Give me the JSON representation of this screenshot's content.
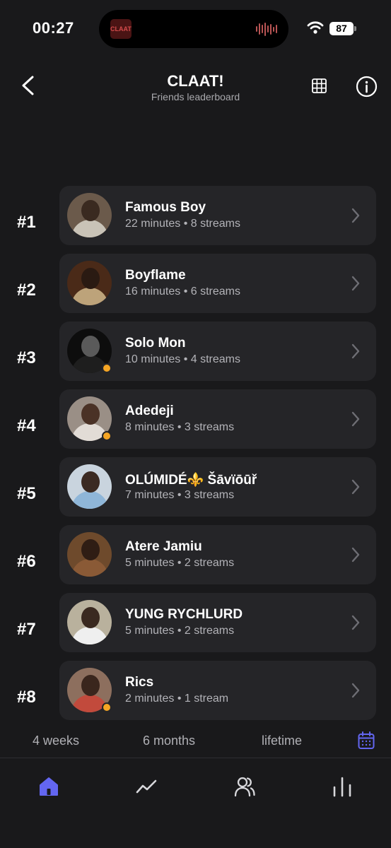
{
  "status_bar": {
    "time": "00:27",
    "battery": "87",
    "island_album_label": "CLAAT!"
  },
  "header": {
    "title": "CLAAT!",
    "subtitle": "Friends leaderboard"
  },
  "leaderboard": [
    {
      "rank": "#1",
      "name": "Famous Boy",
      "stats": "22 minutes • 8 streams",
      "online": false,
      "avatar": {
        "bg": "#6b5a4b",
        "skin": "#3a2a20",
        "shirt": "#c9c3b7"
      }
    },
    {
      "rank": "#2",
      "name": "Boyflame",
      "stats": "16 minutes • 6 streams",
      "online": false,
      "avatar": {
        "bg": "#4a2a18",
        "skin": "#2a1a12",
        "shirt": "#bda37a"
      }
    },
    {
      "rank": "#3",
      "name": "Solo Mon",
      "stats": "10 minutes • 4 streams",
      "online": true,
      "avatar": {
        "bg": "#0d0d0d",
        "skin": "#5a5a5a",
        "shirt": "#1e1e1e"
      }
    },
    {
      "rank": "#4",
      "name": "Adedeji",
      "stats": "8 minutes • 3 streams",
      "online": true,
      "avatar": {
        "bg": "#9a8f86",
        "skin": "#4a3226",
        "shirt": "#e2dcd6"
      }
    },
    {
      "rank": "#5",
      "name": "OLÚMIDÉ⚜️ Šāvïōūř",
      "stats": "7 minutes • 3 streams",
      "online": false,
      "avatar": {
        "bg": "#c9d4de",
        "skin": "#3b2a22",
        "shirt": "#8fb6d8"
      }
    },
    {
      "rank": "#6",
      "name": "Atere Jamiu",
      "stats": "5 minutes • 2 streams",
      "online": false,
      "avatar": {
        "bg": "#6e4a2c",
        "skin": "#2f1d14",
        "shirt": "#8a5a36"
      }
    },
    {
      "rank": "#7",
      "name": "YUNG RYCHLURD",
      "stats": "5 minutes • 2 streams",
      "online": false,
      "avatar": {
        "bg": "#b9b19d",
        "skin": "#3a2920",
        "shirt": "#efefef"
      }
    },
    {
      "rank": "#8",
      "name": "Rics",
      "stats": "2 minutes • 1 stream",
      "online": true,
      "avatar": {
        "bg": "#8d6f5e",
        "skin": "#3a261d",
        "shirt": "#c24a3c"
      }
    }
  ],
  "periods": {
    "tabs": [
      "4 weeks",
      "6 months",
      "lifetime"
    ],
    "calendar_icon": "calendar-icon"
  },
  "tabbar": {
    "items": [
      "home-icon",
      "trend-icon",
      "friends-icon",
      "stats-icon"
    ],
    "active": "home-icon"
  },
  "colors": {
    "background": "#19191b",
    "card": "#252528",
    "accent": "#6366f1",
    "online": "#f5a524"
  }
}
